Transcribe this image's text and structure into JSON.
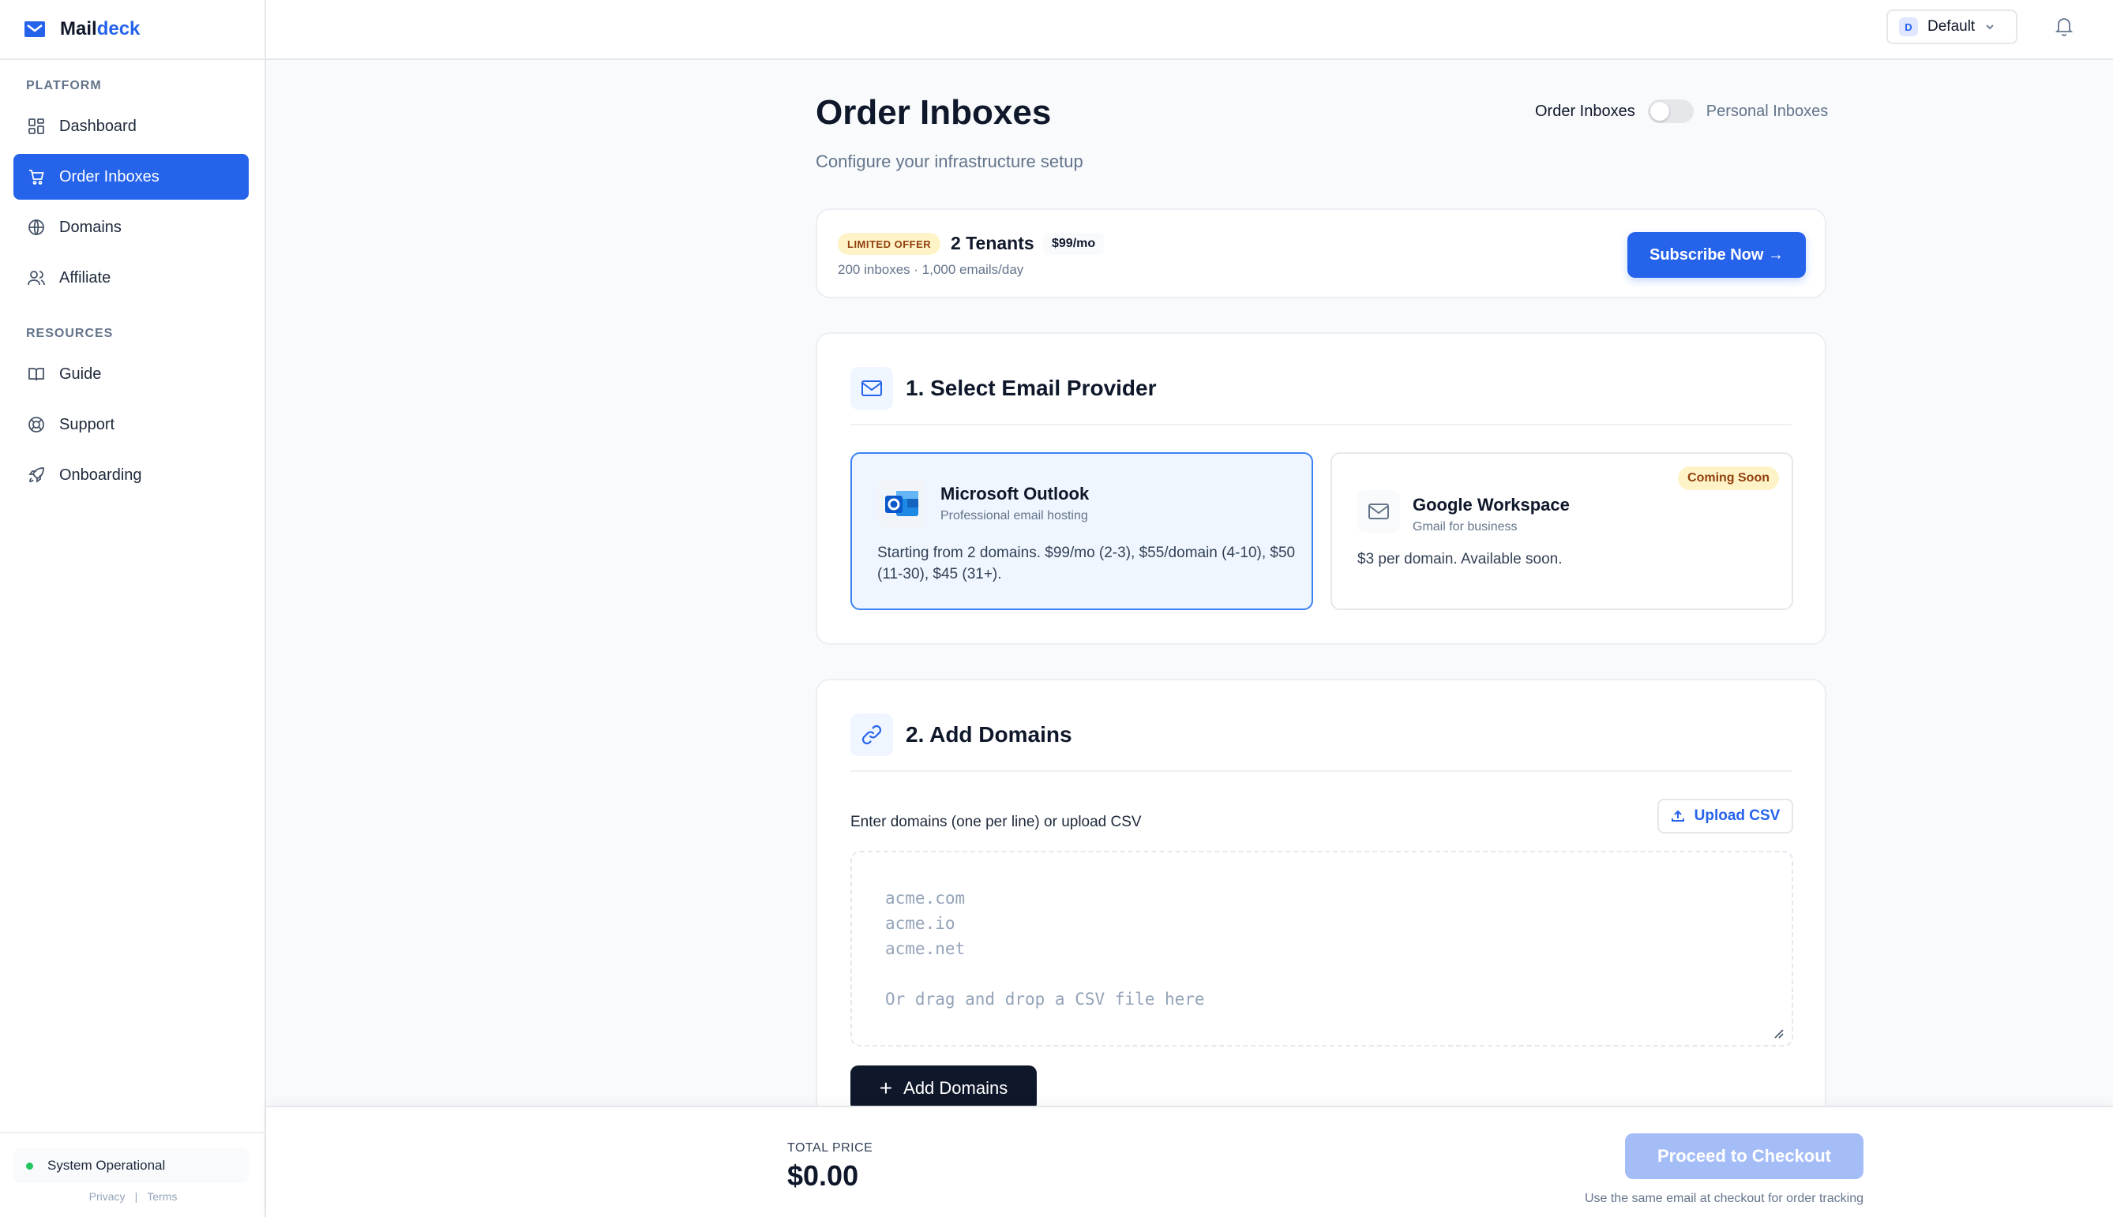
{
  "brand": {
    "name_main": "Mail",
    "name_accent": "deck"
  },
  "sidebar": {
    "platform_heading": "PLATFORM",
    "resources_heading": "RESOURCES",
    "items": [
      {
        "label": "Dashboard",
        "icon": "dashboard-icon"
      },
      {
        "label": "Order Inboxes",
        "icon": "cart-icon",
        "active": true
      },
      {
        "label": "Domains",
        "icon": "globe-icon"
      },
      {
        "label": "Affiliate",
        "icon": "users-icon"
      }
    ],
    "resources": [
      {
        "label": "Guide",
        "icon": "book-icon"
      },
      {
        "label": "Support",
        "icon": "lifebuoy-icon"
      },
      {
        "label": "Onboarding",
        "icon": "rocket-icon"
      }
    ],
    "status": "System Operational",
    "privacy": "Privacy",
    "terms": "Terms",
    "separator": "|"
  },
  "topbar": {
    "workspace_initial": "D",
    "workspace_name": "Default"
  },
  "page": {
    "title": "Order Inboxes",
    "subtitle": "Configure your infrastructure setup",
    "toggle_left": "Order Inboxes",
    "toggle_right": "Personal Inboxes"
  },
  "offer": {
    "badge": "LIMITED OFFER",
    "title": "2 Tenants",
    "price": "$99/mo",
    "details": "200 inboxes · 1,000 emails/day",
    "cta": "Subscribe Now →"
  },
  "provider_section": {
    "title": "1. Select Email Provider",
    "providers": [
      {
        "name": "Microsoft Outlook",
        "tagline": "Professional email hosting",
        "description": "Starting from 2 domains. $99/mo (2-3), $55/domain (4-10), $50 (11-30), $45 (31+)."
      },
      {
        "name": "Google Workspace",
        "tagline": "Gmail for business",
        "description": "$3 per domain. Available soon.",
        "badge": "Coming Soon"
      }
    ]
  },
  "domains_section": {
    "title": "2. Add Domains",
    "label": "Enter domains (one per line) or upload CSV",
    "upload_label": "Upload CSV",
    "placeholder": "acme.com\nacme.io\nacme.net\n\nOr drag and drop a CSV file here",
    "add_button": "Add Domains"
  },
  "footer": {
    "total_label": "TOTAL PRICE",
    "total_value": "$0.00",
    "checkout": "Proceed to Checkout",
    "note": "Use the same email at checkout for order tracking"
  },
  "colors": {
    "accent": "#2563eb",
    "dark": "#0f172a",
    "status_ok": "#22c55e",
    "badge_bg": "#fef3c7"
  }
}
